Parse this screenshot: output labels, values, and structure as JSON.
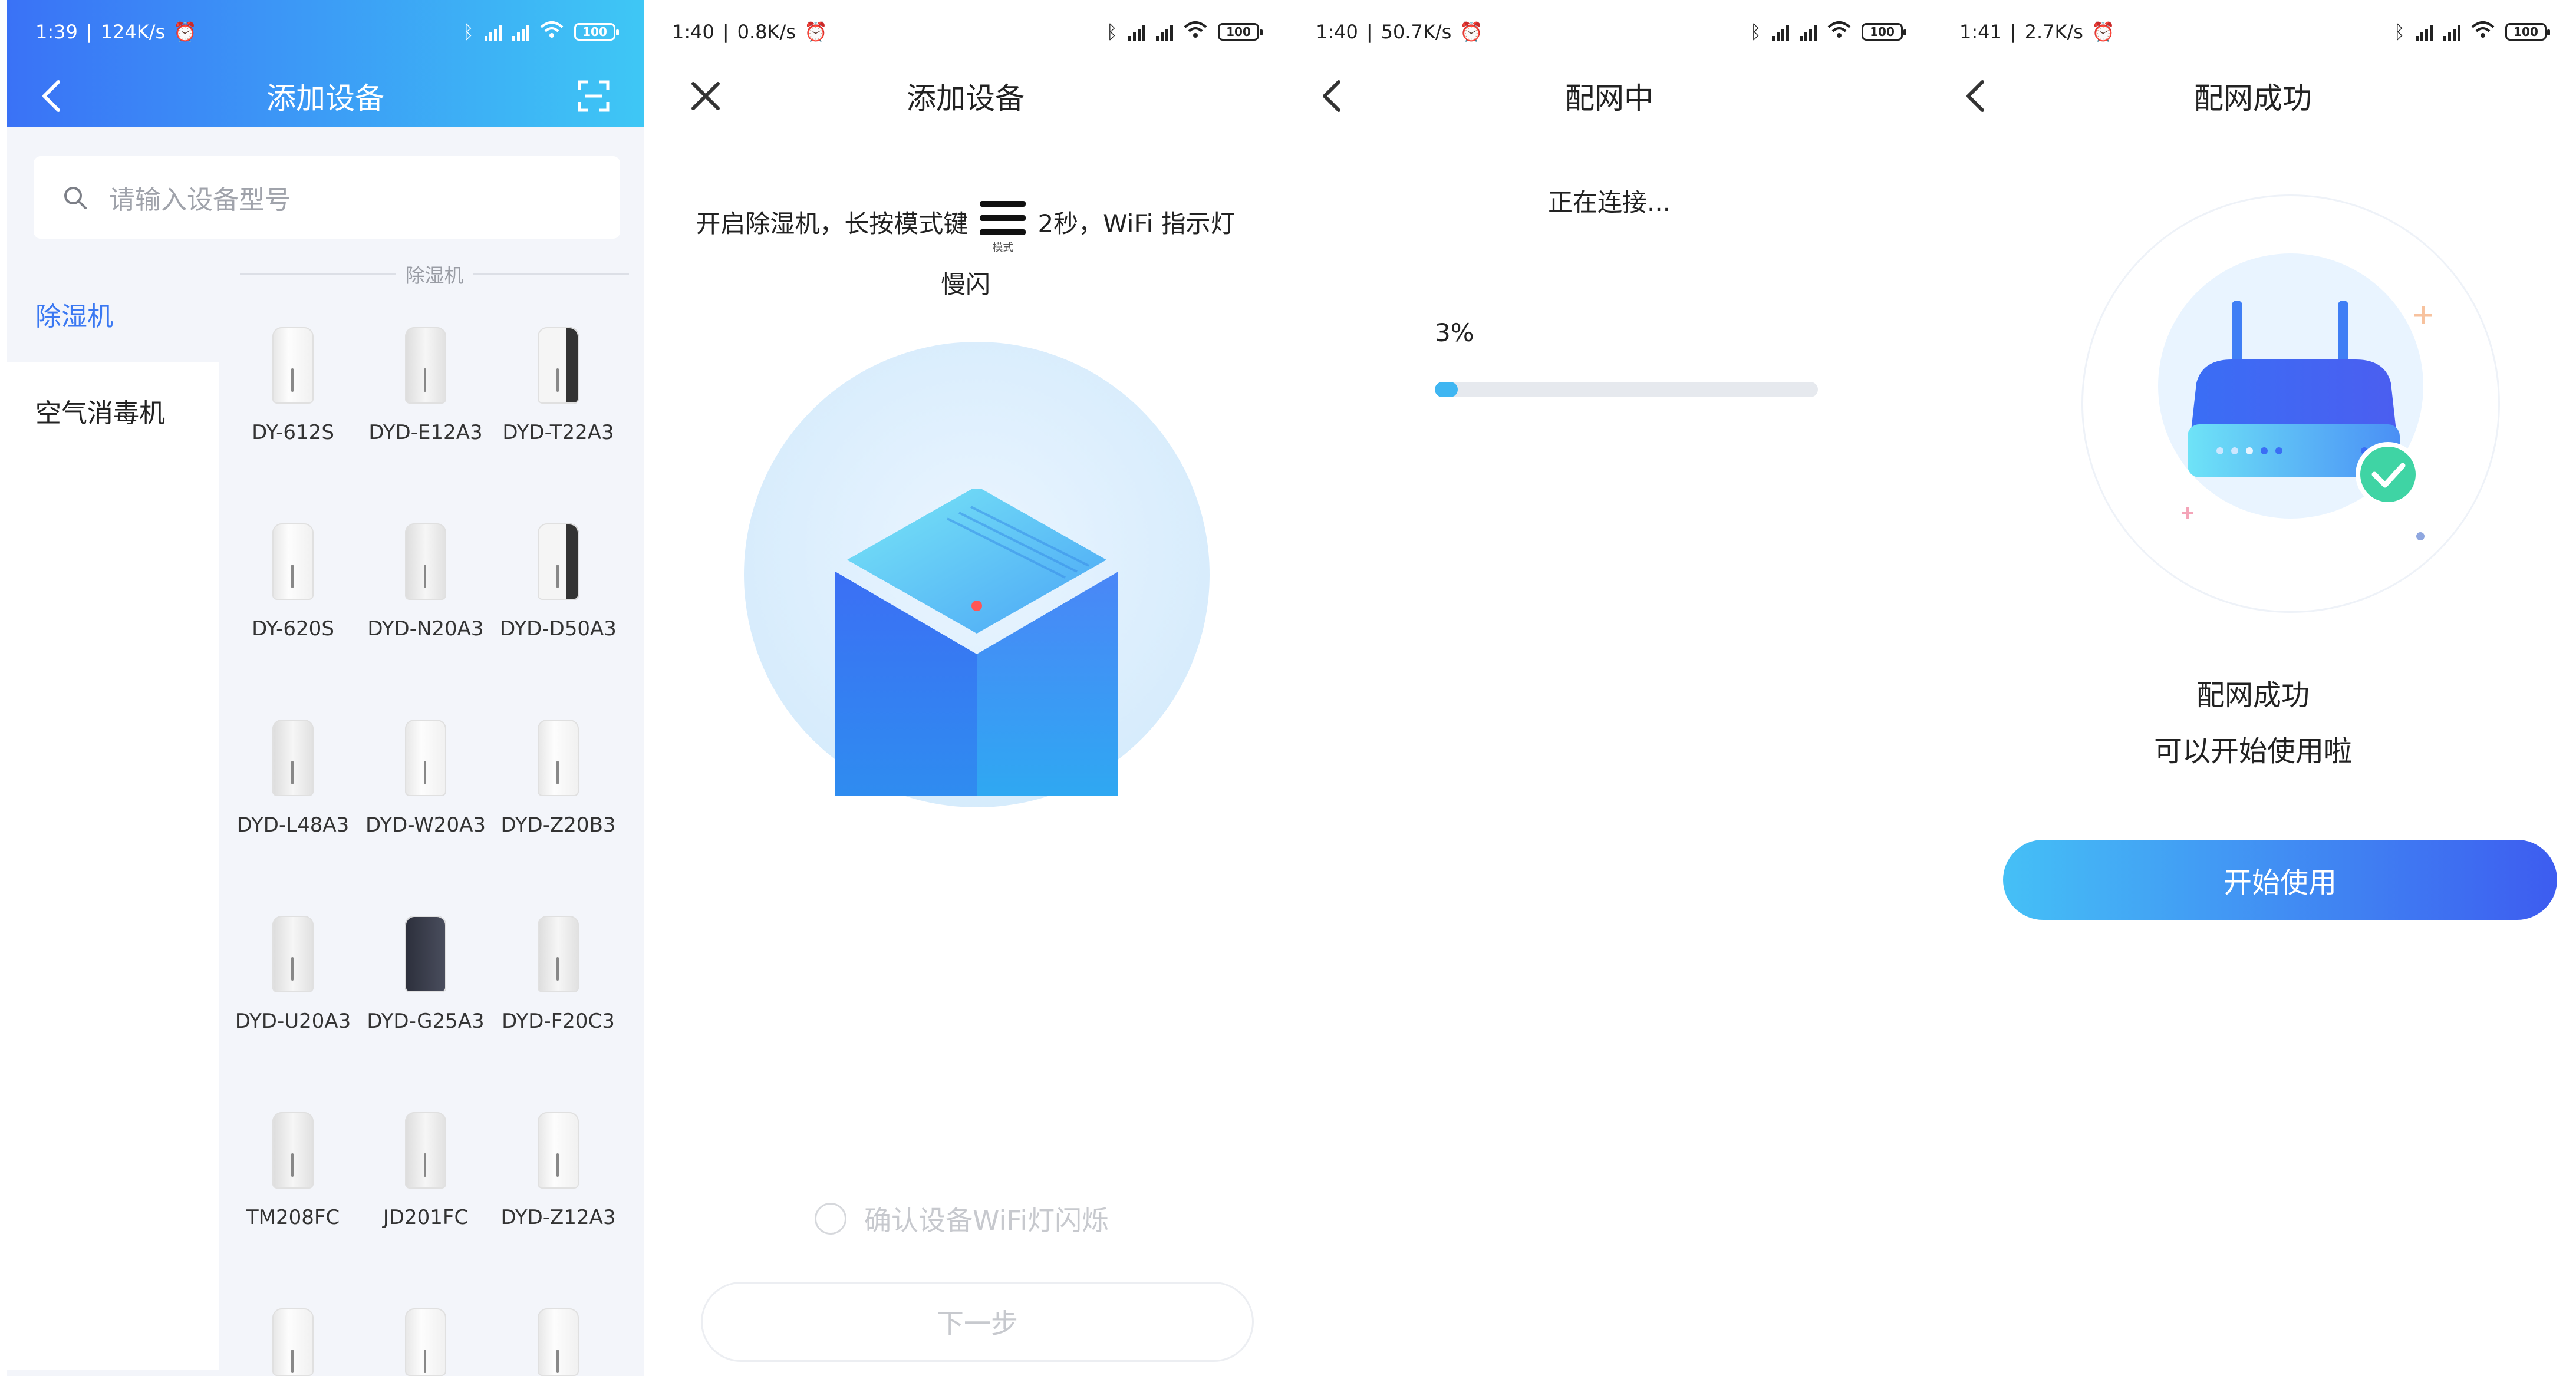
{
  "screens": [
    {
      "status": {
        "time": "1:39",
        "speed": "124K/s",
        "battery": "100"
      },
      "title": "添加设备",
      "search_placeholder": "请输入设备型号",
      "categories": [
        "除湿机",
        "空气消毒机"
      ],
      "section_title": "除湿机",
      "devices": [
        "DY-612S",
        "DYD-E12A3",
        "DYD-T22A3",
        "DY-620S",
        "DYD-N20A3",
        "DYD-D50A3",
        "DYD-L48A3",
        "DYD-W20A3",
        "DYD-Z20B3",
        "DYD-U20A3",
        "DYD-G25A3",
        "DYD-F20C3",
        "TM208FC",
        "JD201FC",
        "DYD-Z12A3",
        "",
        "",
        ""
      ]
    },
    {
      "status": {
        "time": "1:40",
        "speed": "0.8K/s",
        "battery": "100"
      },
      "title": "添加设备",
      "instruction_part1": "开启除湿机，长按模式键",
      "mode_label": "模式",
      "instruction_part2": "2秒，WiFi 指示灯慢闪",
      "confirm_label": "确认设备WiFi灯闪烁",
      "next_button": "下一步"
    },
    {
      "status": {
        "time": "1:40",
        "speed": "50.7K/s",
        "battery": "100"
      },
      "title": "配网中",
      "connecting_text": "正在连接...",
      "progress_label": "3%",
      "progress_value": 0.03
    },
    {
      "status": {
        "time": "1:41",
        "speed": "2.7K/s",
        "battery": "100"
      },
      "title": "配网成功",
      "success_title": "配网成功",
      "success_subtitle": "可以开始使用啦",
      "start_button": "开始使用"
    }
  ],
  "colors": {
    "accent": "#3a78f2",
    "header_start": "#3a72f6",
    "header_end": "#3ec7f5",
    "progress": "#3fb6f2"
  }
}
